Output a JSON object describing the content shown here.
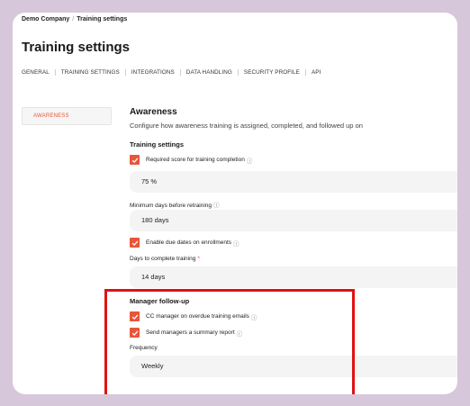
{
  "breadcrumb": {
    "company": "Demo Company",
    "separator": "/",
    "current": "Training settings"
  },
  "page_title": "Training settings",
  "tabs": [
    {
      "label": "GENERAL"
    },
    {
      "label": "TRAINING SETTINGS"
    },
    {
      "label": "INTEGRATIONS"
    },
    {
      "label": "DATA HANDLING"
    },
    {
      "label": "SECURITY PROFILE"
    },
    {
      "label": "API"
    }
  ],
  "sidebar": {
    "items": [
      {
        "label": "AWARENESS"
      }
    ]
  },
  "section": {
    "title": "Awareness",
    "description": "Configure how awareness training is assigned, completed, and followed up on"
  },
  "training_settings": {
    "title": "Training settings",
    "required_score": {
      "label": "Required score for training completion",
      "checked": true,
      "value": "75 %"
    },
    "min_days": {
      "label": "Minimum days before retraining",
      "value": "180 days"
    },
    "due_dates": {
      "label": "Enable due dates on enrollments",
      "checked": true
    },
    "days_to_complete": {
      "label": "Days to complete training",
      "required_mark": "*",
      "value": "14 days"
    }
  },
  "manager_followup": {
    "title": "Manager follow-up",
    "cc_manager": {
      "label": "CC manager on overdue training emails",
      "checked": true
    },
    "summary_report": {
      "label": "Send managers a summary report",
      "checked": true
    },
    "frequency": {
      "label": "Frequency",
      "value": "Weekly"
    }
  },
  "icons": {
    "info": "ⓘ",
    "check": "check-icon"
  },
  "colors": {
    "accent": "#e8553a",
    "highlight": "#e01212",
    "background": "#d7c7da"
  }
}
